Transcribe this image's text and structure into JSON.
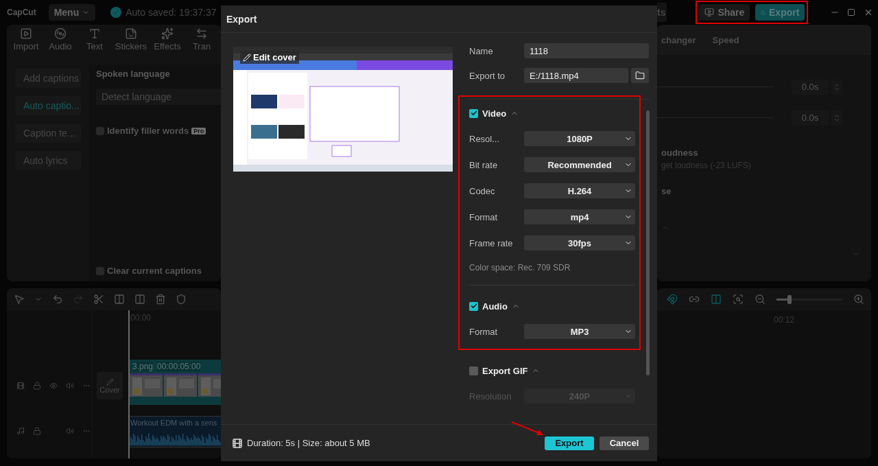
{
  "app": {
    "logo": "CapCut",
    "menu": "Menu",
    "autosave": "Auto saved: 19:37:37",
    "partial_button": "ts",
    "share": "Share",
    "export": "Export"
  },
  "toolbar": [
    {
      "label": "Import"
    },
    {
      "label": "Audio"
    },
    {
      "label": "Text"
    },
    {
      "label": "Stickers"
    },
    {
      "label": "Effects"
    },
    {
      "label": "Tran"
    }
  ],
  "caption_menu": [
    {
      "label": "Add captions",
      "selected": false
    },
    {
      "label": "Auto captio...",
      "selected": true
    },
    {
      "label": "Caption te...",
      "selected": false
    },
    {
      "label": "Auto lyrics",
      "selected": false
    }
  ],
  "captions_panel": {
    "heading": "Spoken language",
    "language": "Detect language",
    "filler": {
      "label": "Identify filler words",
      "badge": "Pro",
      "checked": false
    },
    "clear": {
      "label": "Clear current captions",
      "checked": false
    }
  },
  "right_panel": {
    "tabs": [
      "changer",
      "Speed"
    ],
    "fade_in": "0.0s",
    "fade_out": "0.0s",
    "loudness_title": "oudness",
    "loudness_desc": "get loudness (-23 LUFS)",
    "section_partial": "se"
  },
  "timeline": {
    "ruler_start": "00:00",
    "ruler_right": "00:12",
    "video_clip": {
      "name": "3.png",
      "duration": "00:00:05:00"
    },
    "cover": "Cover",
    "audio_clip": "Workout EDM with a sens",
    "zoom": {
      "level": 0.2
    }
  },
  "dialog": {
    "title": "Export",
    "edit_cover": "Edit cover",
    "name_label": "Name",
    "name": "1118",
    "export_to_label": "Export to",
    "export_to": "E:/1118.mp4",
    "video": {
      "label": "Video",
      "checked": true,
      "expanded": true,
      "settings": [
        {
          "label": "Resol...",
          "value": "1080P",
          "disabled": false
        },
        {
          "label": "Bit rate",
          "value": "Recommended",
          "disabled": false
        },
        {
          "label": "Codec",
          "value": "H.264",
          "disabled": false
        },
        {
          "label": "Format",
          "value": "mp4",
          "disabled": false
        },
        {
          "label": "Frame rate",
          "value": "30fps",
          "disabled": false
        }
      ],
      "color_space": "Color space: Rec. 709 SDR"
    },
    "audio": {
      "label": "Audio",
      "checked": true,
      "expanded": true,
      "settings": [
        {
          "label": "Format",
          "value": "MP3",
          "disabled": false
        }
      ]
    },
    "gif": {
      "label": "Export GIF",
      "checked": false,
      "expanded": true,
      "settings": [
        {
          "label": "Resolution",
          "value": "240P",
          "disabled": true
        }
      ]
    },
    "footer": {
      "info": "Duration: 5s | Size: about 5 MB",
      "export": "Export",
      "cancel": "Cancel"
    }
  }
}
